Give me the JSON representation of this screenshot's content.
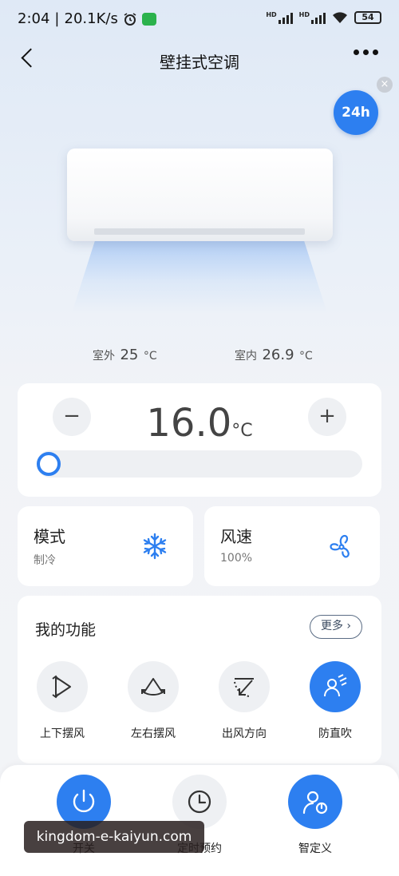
{
  "status": {
    "time": "2:04",
    "speed": "20.1K/s",
    "net1": "HD",
    "net2": "HD",
    "battery": "54"
  },
  "nav": {
    "title": "壁挂式空调"
  },
  "service": {
    "badge": "24h"
  },
  "climate": {
    "outdoor_label": "室外",
    "outdoor_value": "25",
    "outdoor_unit": "°C",
    "indoor_label": "室内",
    "indoor_value": "26.9",
    "indoor_unit": "°C"
  },
  "temperature": {
    "minus": "−",
    "plus": "+",
    "value": "16.0",
    "unit": "°C",
    "slider_level": 0
  },
  "mode": {
    "title": "模式",
    "value": "制冷"
  },
  "fan": {
    "title": "风速",
    "value": "100%"
  },
  "functions": {
    "title": "我的功能",
    "more_label": "更多 ›",
    "items": [
      {
        "label": "上下摆风",
        "icon": "swing-vertical-icon"
      },
      {
        "label": "左右摆风",
        "icon": "swing-horizontal-icon"
      },
      {
        "label": "出风方向",
        "icon": "air-direction-icon"
      },
      {
        "label": "防直吹",
        "icon": "anti-direct-blow-icon"
      }
    ]
  },
  "bottom": {
    "items": [
      {
        "label": "开关",
        "icon": "power-icon"
      },
      {
        "label": "定时预约",
        "icon": "clock-icon"
      },
      {
        "label": "智定义",
        "icon": "smart-custom-icon"
      }
    ]
  },
  "watermark": {
    "text": "kingdom-e-kaiyun.com"
  },
  "colors": {
    "accent": "#2d7ff0",
    "card": "#ffffff",
    "background": "#f3f4f7"
  }
}
